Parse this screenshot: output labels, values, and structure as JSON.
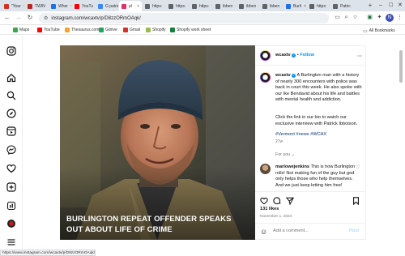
{
  "browser": {
    "tabs": [
      {
        "label": "\"Your",
        "color": "#d93025"
      },
      {
        "label": "TWIN",
        "color": "#c5221f"
      },
      {
        "label": "Wher",
        "color": "#1a73e8"
      },
      {
        "label": "YouTu",
        "color": "#ff0000"
      },
      {
        "label": "G patric",
        "color": "#4285f4"
      },
      {
        "label": "pl",
        "color": "#e1306c"
      },
      {
        "label": "https:",
        "color": "#5f6368"
      },
      {
        "label": "https:",
        "color": "#5f6368"
      },
      {
        "label": "https:",
        "color": "#5f6368"
      },
      {
        "label": "ibben",
        "color": "#5f6368"
      },
      {
        "label": "ibben",
        "color": "#5f6368"
      },
      {
        "label": "ibben",
        "color": "#5f6368"
      },
      {
        "label": "Burli",
        "color": "#1a73e8"
      },
      {
        "label": "https:",
        "color": "#5f6368"
      },
      {
        "label": "Patric",
        "color": "#5f6368"
      }
    ],
    "url": "instagram.com/wcaxtv/p/D8zzORmOAqk/",
    "profile_initial": "N",
    "bookmarks": [
      {
        "label": "Maps",
        "color": "#34a853"
      },
      {
        "label": "YouTube",
        "color": "#ff0000"
      },
      {
        "label": "Thesaurus.com",
        "color": "#f5a623"
      },
      {
        "label": "Gdrive",
        "color": "#1fa463"
      },
      {
        "label": "Gmail",
        "color": "#d93025"
      },
      {
        "label": "Shopify",
        "color": "#95bf47"
      },
      {
        "label": "Shopify work sheet",
        "color": "#188038"
      }
    ],
    "all_bookmarks": "All Bookmarks",
    "status_url": "https://www.instagram.com/wcaxtv/p/D8zzORmOAqk/#"
  },
  "post": {
    "caption_overlay": "BURLINGTON REPEAT OFFENDER SPEAKS OUT ABOUT LIFE OF CRIME",
    "account": "wcaxtv",
    "follow": "Follow",
    "separator": "•",
    "caption_text": "A Burlington man with a history of nearly 300 encounters with police was back in court this week. He also spoke with our Ike Bendavid about his life and battles with mental health and addiction.",
    "caption_text2": "Click the link in our bio to watch our exclusive interview with Patrick Ibbotson.",
    "hashtags": "#Vermont #news #WCAX",
    "age": "27w",
    "for_you": "For you",
    "comment_user": "marlowejenkins",
    "comment_text": "This is how Burlington rolls! Not making fun of the guy but god only helps those who help themselves. And we just keep letting him free!",
    "likes": "131 likes",
    "date": "November 1, 2024",
    "add_comment_placeholder": "Add a comment...",
    "post_button": "Post"
  },
  "colors": {
    "link_blue": "#0095f6",
    "hashtag_blue": "#00376b"
  }
}
